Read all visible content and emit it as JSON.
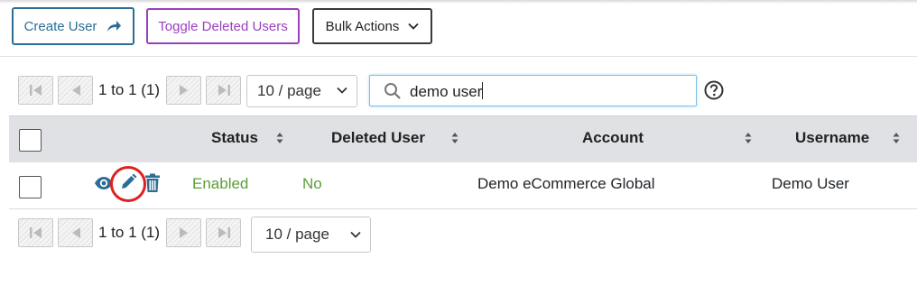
{
  "toolbar": {
    "create_user": "Create User",
    "toggle_deleted": "Toggle Deleted Users",
    "bulk_actions": "Bulk Actions"
  },
  "pagination_top": {
    "range": "1 to 1 (1)",
    "per_page": "10 / page"
  },
  "search": {
    "value": "demo user"
  },
  "table": {
    "columns": [
      "Status",
      "Deleted User",
      "Account",
      "Username"
    ],
    "rows": [
      {
        "status": "Enabled",
        "deleted_user": "No",
        "account": "Demo eCommerce Global",
        "username": "Demo User"
      }
    ]
  },
  "pagination_bottom": {
    "range": "1 to 1 (1)",
    "per_page": "10 / page"
  },
  "colors": {
    "primary": "#2a6e96",
    "toggle": "#9b3fbf",
    "enabled": "#5a9e3a",
    "highlight": "#e02020",
    "header_bg": "#dfe1e5"
  },
  "icons": {
    "create": "share-arrow-icon",
    "bulk": "chevron-down-icon",
    "search": "search-icon",
    "help": "help-circle-icon",
    "view": "eye-icon",
    "edit": "pencil-icon",
    "delete": "trash-icon"
  }
}
